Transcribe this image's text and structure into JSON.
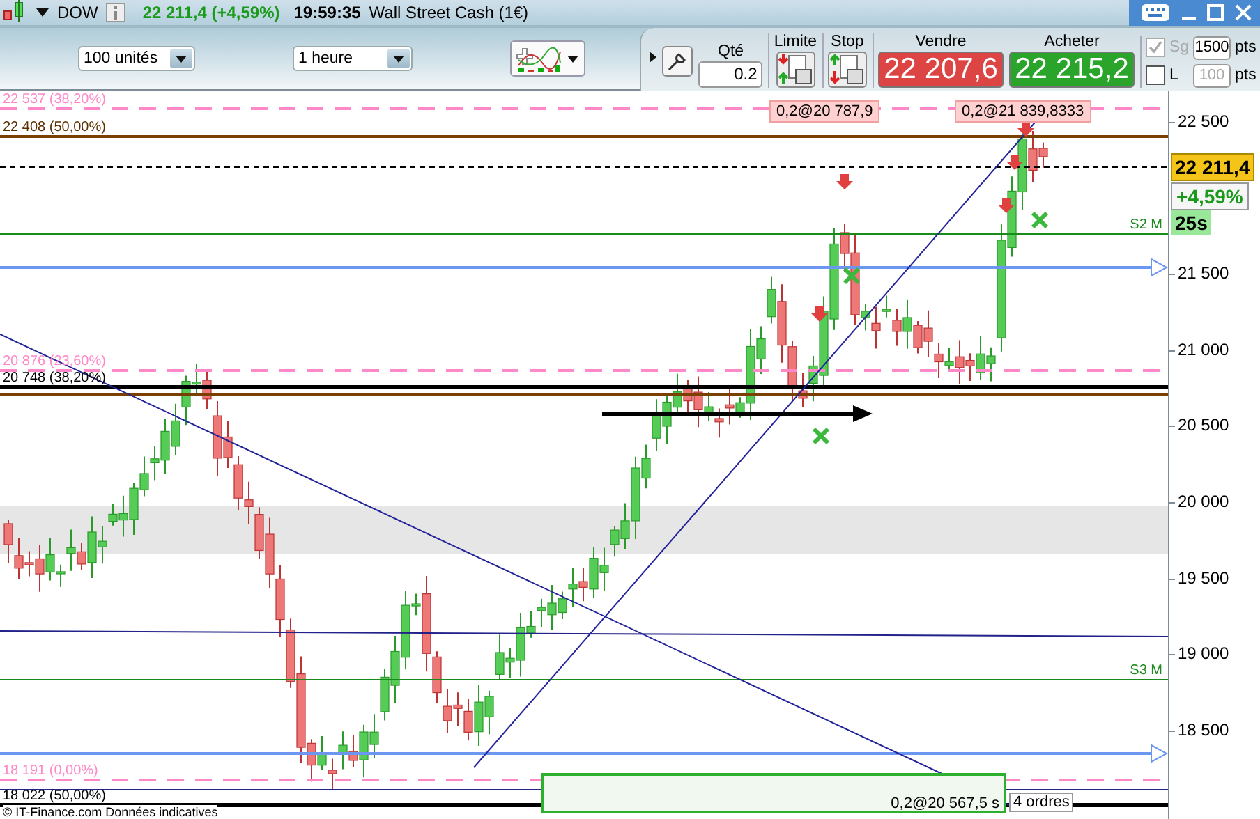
{
  "titlebar": {
    "symbol": "DOW",
    "quote": "22 211,4 (+4,59%)",
    "time": "19:59:35",
    "instrument": "Wall Street Cash (1€)"
  },
  "toolbar": {
    "quantity_select": "100 unités",
    "period_select": "1 heure"
  },
  "order_panel": {
    "qty_label": "Qté",
    "qty_value": "0.2",
    "limit_label": "Limite",
    "stop_label": "Stop",
    "sell_label": "Vendre",
    "sell_price": "22 207,6",
    "buy_label": "Acheter",
    "buy_price": "22 215,2",
    "options": [
      {
        "label": "Sg",
        "checked": true,
        "disabled": true,
        "value": "1500",
        "unit": "pts"
      },
      {
        "label": "L",
        "checked": false,
        "disabled": false,
        "value": "100",
        "unit": "pts"
      }
    ]
  },
  "chart": {
    "levels": [
      {
        "kind": "fib",
        "label": "22 537 (38,20%)"
      },
      {
        "kind": "retrace",
        "label": "22 408 (50,00%)"
      },
      {
        "kind": "fib",
        "label": "20 876 (23,60%)"
      },
      {
        "kind": "black",
        "label": "20 748 (38,20%)"
      },
      {
        "kind": "pivot",
        "label": "S2 M"
      },
      {
        "kind": "pivot",
        "label": "S3 M"
      },
      {
        "kind": "fib",
        "label": "18 191 (0,00%)"
      },
      {
        "kind": "black",
        "label": "18 022 (50,00%)"
      }
    ],
    "axis_labels": [
      "22 500",
      "21 500",
      "21 000",
      "20 500",
      "20 000",
      "19 500",
      "19 000",
      "18 500"
    ],
    "price_tag": "22 211,4",
    "change_tag": "+4,59%",
    "countdown": "25s",
    "order_tags": [
      "0,2@20 787,9",
      "0,2@21 839,8333"
    ],
    "pending_order": "0,2@20 567,5 s",
    "orders_count": "4 ordres",
    "copyright": "© IT-Finance.com Données indicatives"
  }
}
